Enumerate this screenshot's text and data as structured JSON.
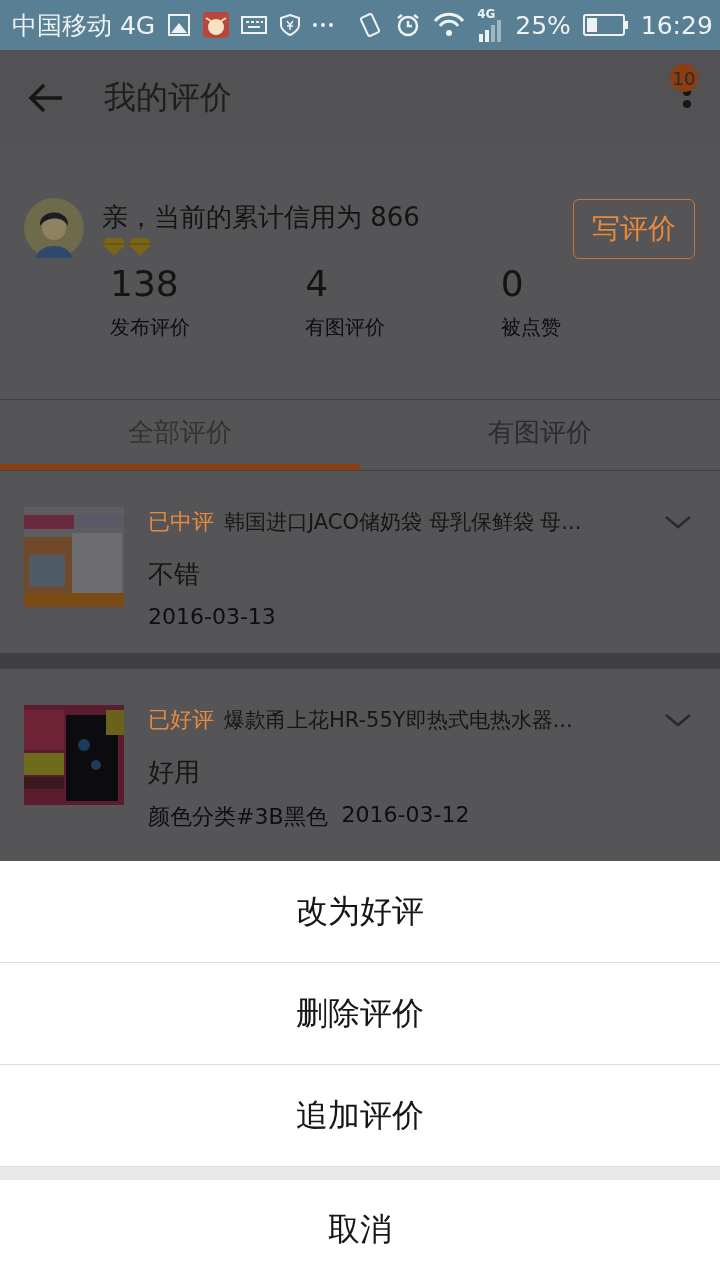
{
  "status_bar": {
    "carrier": "中国移动 4G",
    "network": "4G",
    "battery": "25%",
    "time": "16:29"
  },
  "header": {
    "title": "我的评价",
    "badge": "10"
  },
  "profile": {
    "credit_text": "亲，当前的累计信用为 866",
    "write_button": "写评价",
    "stats": [
      {
        "value": "138",
        "label": "发布评价"
      },
      {
        "value": "4",
        "label": "有图评价"
      },
      {
        "value": "0",
        "label": "被点赞"
      }
    ]
  },
  "tabs": [
    {
      "label": "全部评价",
      "selected": true
    },
    {
      "label": "有图评价",
      "selected": false
    }
  ],
  "reviews": [
    {
      "rating": "已中评",
      "title": "韩国进口JACO储奶袋 母乳保鲜袋 母...",
      "comment": "不错",
      "date": "2016-03-13"
    },
    {
      "rating": "已好评",
      "title": "爆款甬上花HR-55Y即热式电热水器...",
      "comment": "好用",
      "variant": "颜色分类#3B黑色",
      "date": "2016-03-12"
    }
  ],
  "action_sheet": {
    "actions": [
      "改为好评",
      "删除评价",
      "追加评价"
    ],
    "cancel": "取消"
  }
}
